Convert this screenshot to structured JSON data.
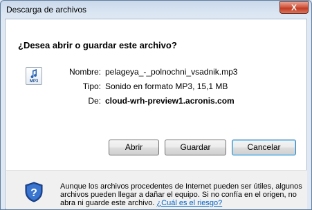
{
  "window": {
    "title": "Descarga de archivos",
    "close_label": "X"
  },
  "dialog": {
    "question": "¿Desea abrir o guardar este archivo?",
    "file_icon_label": "MP3",
    "fields": [
      {
        "label": "Nombre:",
        "value": "pelageya_-_polnochni_vsadnik.mp3"
      },
      {
        "label": "Tipo:",
        "value": "Sonido en formato MP3, 15,1 MB"
      },
      {
        "label": "De:",
        "value": "cloud-wrh-preview1.acronis.com"
      }
    ],
    "buttons": {
      "open": "Abrir",
      "save": "Guardar",
      "cancel": "Cancelar"
    },
    "warning_text": "Aunque los archivos procedentes de Internet pueden ser útiles, algunos archivos pueden llegar a dañar el equipo. Si no confía en el origen, no abra ni guarde este archivo.",
    "risk_link": "¿Cuál es el riesgo?"
  },
  "colors": {
    "link": "#0066cc",
    "shield_blue": "#1f4ea3",
    "close_red": "#c23a22"
  }
}
